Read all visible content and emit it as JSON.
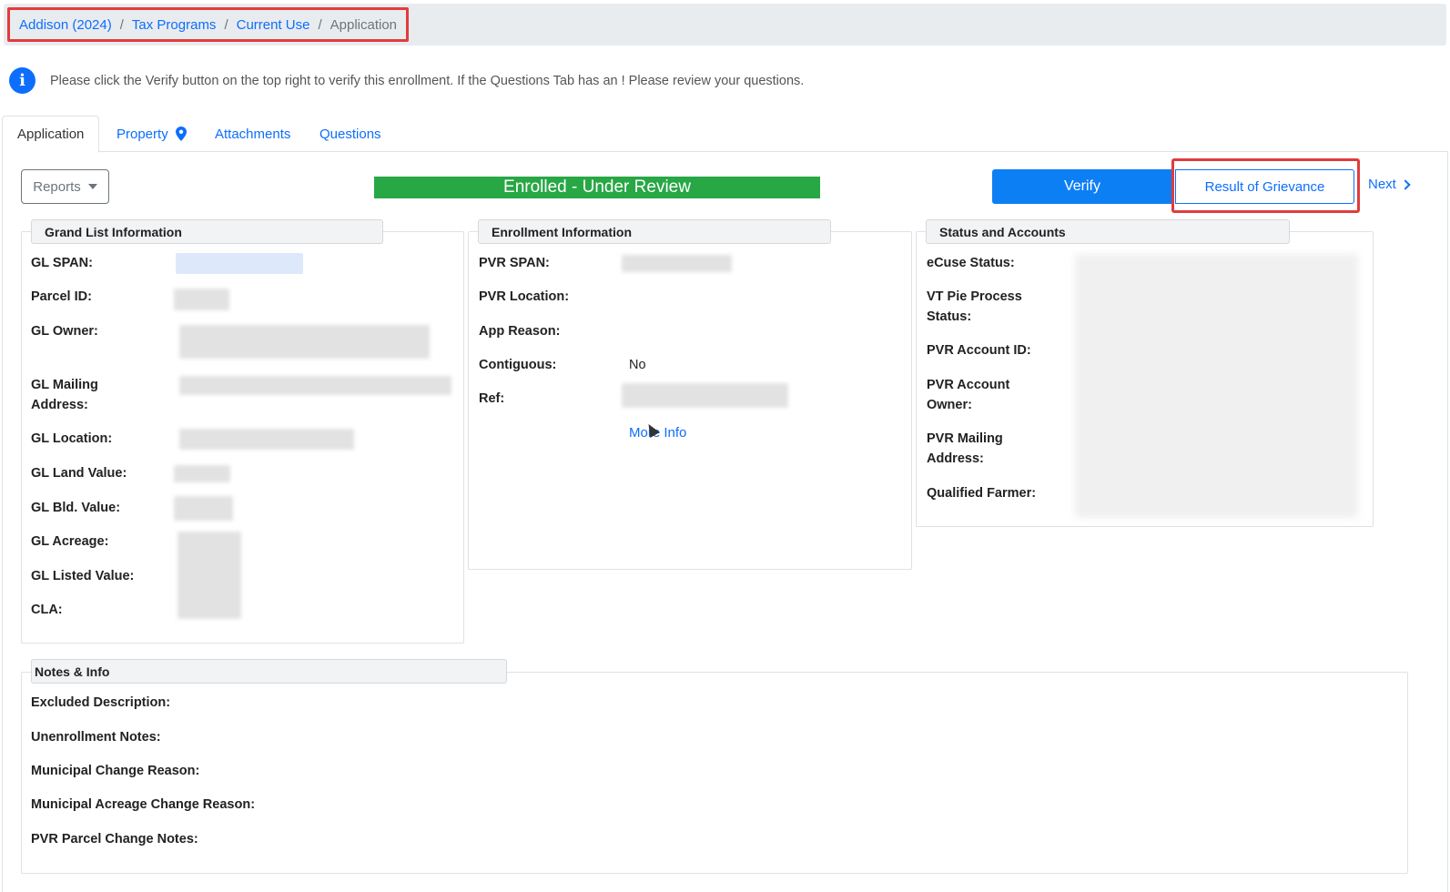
{
  "breadcrumb": {
    "items": [
      "Addison (2024)",
      "Tax Programs",
      "Current Use"
    ],
    "current": "Application",
    "separator": "/"
  },
  "info": {
    "message": "Please click the Verify button on the top right to verify this enrollment. If the Questions Tab has an ! Please review your questions."
  },
  "tabs": [
    "Application",
    "Property",
    "Attachments",
    "Questions"
  ],
  "toolbar": {
    "reports_label": "Reports",
    "status_text": "Enrolled - Under Review",
    "verify_label": "Verify",
    "grievance_label": "Result of Grievance",
    "next_label": "Next"
  },
  "grand_list": {
    "title": "Grand List Information",
    "labels": {
      "span": "GL SPAN:",
      "parcel": "Parcel ID:",
      "owner": "GL Owner:",
      "mailing": "GL Mailing Address:",
      "location": "GL Location:",
      "land": "GL Land Value:",
      "bld": "GL Bld. Value:",
      "acreage": "GL Acreage:",
      "listed": "GL Listed Value:",
      "cla": "CLA:"
    }
  },
  "enrollment": {
    "title": "Enrollment Information",
    "labels": {
      "pvr_span": "PVR SPAN:",
      "pvr_location": "PVR Location:",
      "app_reason": "App Reason:",
      "contiguous": "Contiguous:",
      "ref": "Ref:"
    },
    "contiguous_value": "No",
    "more_info_label": "More Info"
  },
  "status_accounts": {
    "title": "Status and Accounts",
    "labels": {
      "ecuse": "eCuse Status:",
      "vt_pie": "VT Pie Process Status:",
      "account_id": "PVR Account ID:",
      "account_owner": "PVR Account Owner:",
      "mailing": "PVR Mailing Address:",
      "farmer": "Qualified Farmer:"
    }
  },
  "notes": {
    "title": "Notes & Info",
    "labels": {
      "excluded": "Excluded Description:",
      "unenrollment": "Unenrollment Notes:",
      "municipal_change": "Municipal Change Reason:",
      "municipal_acreage": "Municipal Acreage Change Reason:",
      "pvr_parcel": "PVR Parcel Change Notes:"
    }
  },
  "colors": {
    "primary": "#0d6efd",
    "status_green": "#28a745",
    "highlight_red": "#e03c3c"
  }
}
